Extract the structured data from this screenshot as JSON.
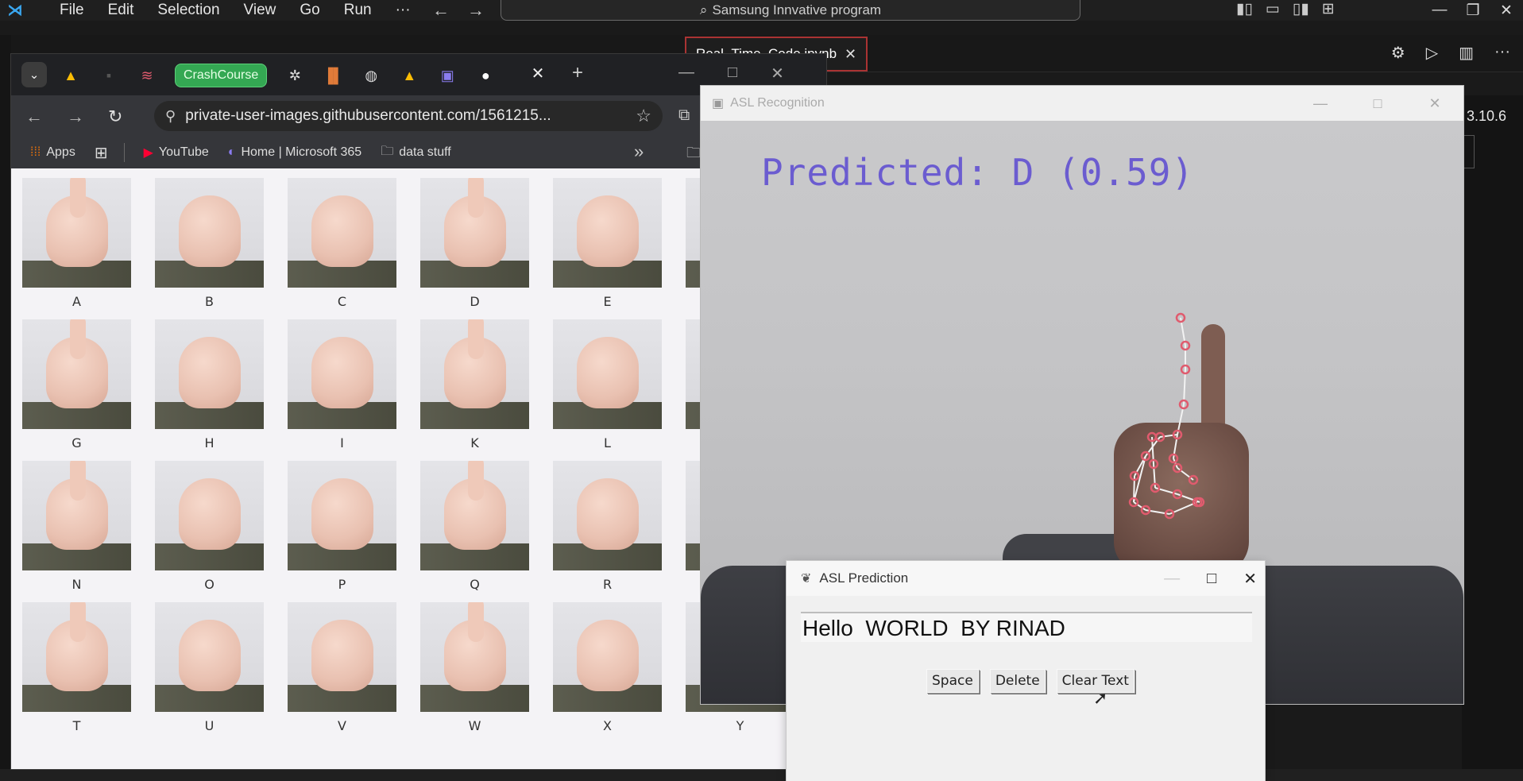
{
  "vscode": {
    "menu": [
      "File",
      "Edit",
      "Selection",
      "View",
      "Go",
      "Run",
      "···"
    ],
    "search_text": "Samsung Innvative program",
    "editor_tab": "Real_Time_Code.ipynb",
    "kernel_version": "3.10.6"
  },
  "chrome": {
    "pinned_tab_label": "CrashCourse",
    "url": "private-user-images.githubusercontent.com/1561215...",
    "bookmarks": [
      "Apps",
      "YouTube",
      "Home | Microsoft 365",
      "data stuff"
    ],
    "asl_letters": [
      "A",
      "B",
      "C",
      "D",
      "E",
      "",
      "G",
      "H",
      "I",
      "K",
      "L",
      "",
      "N",
      "O",
      "P",
      "Q",
      "R",
      "",
      "T",
      "U",
      "V",
      "W",
      "X",
      "Y"
    ]
  },
  "asl_recognition": {
    "title": "ASL Recognition",
    "predicted_label": "Predicted: D (0.59)"
  },
  "asl_prediction": {
    "title": "ASL Prediction",
    "text_value": "Hello  WORLD  BY RINAD",
    "buttons": {
      "space": "Space",
      "delete": "Delete",
      "clear": "Clear Text"
    }
  },
  "colors": {
    "prediction_text": "#6b5cd0",
    "landmark_point": "#e05b6e",
    "pinned_tab": "#34a853"
  }
}
